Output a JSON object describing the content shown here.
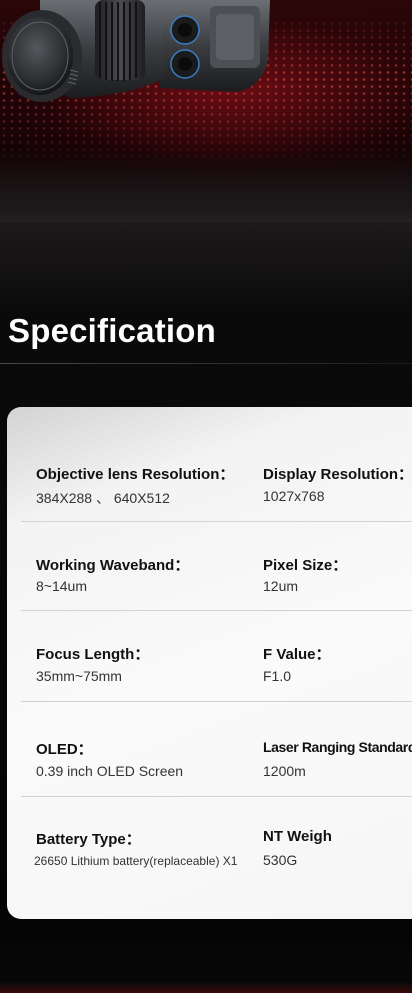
{
  "section": {
    "title": "Specification"
  },
  "specs": [
    [
      {
        "label": "Objective lens Resolution：",
        "value": "384X288 、 640X512"
      },
      {
        "label": "Display Resolution：",
        "value": "1027x768"
      }
    ],
    [
      {
        "label": "Working Waveband：",
        "value": "8~14um"
      },
      {
        "label": "Pixel Size：",
        "value": "12um"
      }
    ],
    [
      {
        "label": "Focus Length：",
        "value": "35mm~75mm"
      },
      {
        "label": "F Value：",
        "value": "F1.0"
      }
    ],
    [
      {
        "label": "OLED：",
        "value": "0.39 inch OLED Screen"
      },
      {
        "label": "Laser Ranging Standard",
        "value": "1200m"
      }
    ],
    [
      {
        "label": "Battery Type：",
        "value": "26650 Lithium battery(replaceable) X1"
      },
      {
        "label": "NT Weigh",
        "value": "530G"
      }
    ]
  ],
  "colors": {
    "background": "#050505",
    "card": "#f7f7f7",
    "accent_red": "#b3141e"
  }
}
